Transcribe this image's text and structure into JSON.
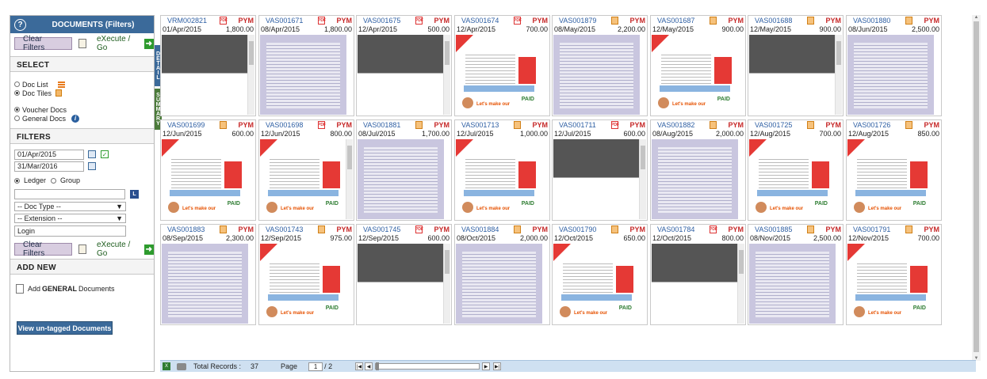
{
  "sidebar": {
    "header_title": "DOCUMENTS (Filters)",
    "help_glyph": "?",
    "clear_filters_label": "Clear Filters",
    "execute_label": "eXecute / Go",
    "select_heading": "SELECT",
    "view_options": [
      "Doc List",
      "Doc Tiles"
    ],
    "view_selected": "Doc Tiles",
    "doc_category_options": [
      "Voucher Docs",
      "General Docs"
    ],
    "doc_category_selected": "Voucher Docs",
    "filters_heading": "FILTERS",
    "date_from": "01/Apr/2015",
    "date_to": "31/Mar/2016",
    "party_options": [
      "Ledger",
      "Group"
    ],
    "party_selected": "Ledger",
    "ledger_value": "",
    "doc_type_select": "-- Doc Type --",
    "extension_select": "-- Extension --",
    "login_value": "Login",
    "add_new_heading": "ADD NEW",
    "add_general_prefix": "Add ",
    "add_general_bold": "GENERAL",
    "add_general_suffix": " Documents",
    "untagged_button": "View un-tagged Documents"
  },
  "side_tabs": {
    "detail": "DETAIL",
    "summary": "SUMMARY"
  },
  "tiles": [
    {
      "doc_no": "VRM002821",
      "file_type": "pdf",
      "type": "PYM",
      "date": "01/Apr/2015",
      "amount": "1,800.00",
      "thumb": "dark",
      "scroll": true
    },
    {
      "doc_no": "VAS001671",
      "file_type": "pdf",
      "type": "PYM",
      "date": "08/Apr/2015",
      "amount": "1,800.00",
      "thumb": "scan",
      "scroll": false
    },
    {
      "doc_no": "VAS001675",
      "file_type": "pdf",
      "type": "PYM",
      "date": "12/Apr/2015",
      "amount": "500.00",
      "thumb": "dark",
      "scroll": true
    },
    {
      "doc_no": "VAS001674",
      "file_type": "pdf",
      "type": "PYM",
      "date": "12/Apr/2015",
      "amount": "700.00",
      "thumb": "bill",
      "scroll": false
    },
    {
      "doc_no": "VAS001879",
      "file_type": "img",
      "type": "PYM",
      "date": "08/May/2015",
      "amount": "2,200.00",
      "thumb": "scan",
      "scroll": false
    },
    {
      "doc_no": "VAS001687",
      "file_type": "img",
      "type": "PYM",
      "date": "12/May/2015",
      "amount": "900.00",
      "thumb": "bill",
      "scroll": false
    },
    {
      "doc_no": "VAS001688",
      "file_type": "img",
      "type": "PYM",
      "date": "12/May/2015",
      "amount": "900.00",
      "thumb": "dark",
      "scroll": true
    },
    {
      "doc_no": "VAS001880",
      "file_type": "img",
      "type": "PYM",
      "date": "08/Jun/2015",
      "amount": "2,500.00",
      "thumb": "scan",
      "scroll": false
    },
    {
      "doc_no": "VAS001699",
      "file_type": "img",
      "type": "PYM",
      "date": "12/Jun/2015",
      "amount": "600.00",
      "thumb": "bill",
      "scroll": false
    },
    {
      "doc_no": "VAS001698",
      "file_type": "pdf",
      "type": "PYM",
      "date": "12/Jun/2015",
      "amount": "800.00",
      "thumb": "bill",
      "scroll": true
    },
    {
      "doc_no": "VAS001881",
      "file_type": "img",
      "type": "PYM",
      "date": "08/Jul/2015",
      "amount": "1,700.00",
      "thumb": "scan",
      "scroll": false
    },
    {
      "doc_no": "VAS001713",
      "file_type": "img",
      "type": "PYM",
      "date": "12/Jul/2015",
      "amount": "1,000.00",
      "thumb": "bill",
      "scroll": false
    },
    {
      "doc_no": "VAS001711",
      "file_type": "pdf",
      "type": "PYM",
      "date": "12/Jul/2015",
      "amount": "600.00",
      "thumb": "dark",
      "scroll": true
    },
    {
      "doc_no": "VAS001882",
      "file_type": "img",
      "type": "PYM",
      "date": "08/Aug/2015",
      "amount": "2,000.00",
      "thumb": "scan",
      "scroll": false
    },
    {
      "doc_no": "VAS001725",
      "file_type": "img",
      "type": "PYM",
      "date": "12/Aug/2015",
      "amount": "700.00",
      "thumb": "bill",
      "scroll": false
    },
    {
      "doc_no": "VAS001726",
      "file_type": "img",
      "type": "PYM",
      "date": "12/Aug/2015",
      "amount": "850.00",
      "thumb": "bill",
      "scroll": false
    },
    {
      "doc_no": "VAS001883",
      "file_type": "img",
      "type": "PYM",
      "date": "08/Sep/2015",
      "amount": "2,300.00",
      "thumb": "scan",
      "scroll": false
    },
    {
      "doc_no": "VAS001743",
      "file_type": "img",
      "type": "PYM",
      "date": "12/Sep/2015",
      "amount": "975.00",
      "thumb": "bill",
      "scroll": false
    },
    {
      "doc_no": "VAS001745",
      "file_type": "pdf",
      "type": "PYM",
      "date": "12/Sep/2015",
      "amount": "600.00",
      "thumb": "dark",
      "scroll": true
    },
    {
      "doc_no": "VAS001884",
      "file_type": "img",
      "type": "PYM",
      "date": "08/Oct/2015",
      "amount": "2,000.00",
      "thumb": "scan",
      "scroll": false
    },
    {
      "doc_no": "VAS001790",
      "file_type": "img",
      "type": "PYM",
      "date": "12/Oct/2015",
      "amount": "650.00",
      "thumb": "bill",
      "scroll": false
    },
    {
      "doc_no": "VAS001784",
      "file_type": "pdf",
      "type": "PYM",
      "date": "12/Oct/2015",
      "amount": "800.00",
      "thumb": "dark",
      "scroll": true
    },
    {
      "doc_no": "VAS001885",
      "file_type": "img",
      "type": "PYM",
      "date": "08/Nov/2015",
      "amount": "2,500.00",
      "thumb": "scan",
      "scroll": false
    },
    {
      "doc_no": "VAS001791",
      "file_type": "img",
      "type": "PYM",
      "date": "12/Nov/2015",
      "amount": "700.00",
      "thumb": "bill",
      "scroll": false
    }
  ],
  "pager": {
    "total_label": "Total Records :",
    "total_value": "37",
    "page_label": "Page",
    "page_current": "1",
    "page_total": "/ 2"
  }
}
